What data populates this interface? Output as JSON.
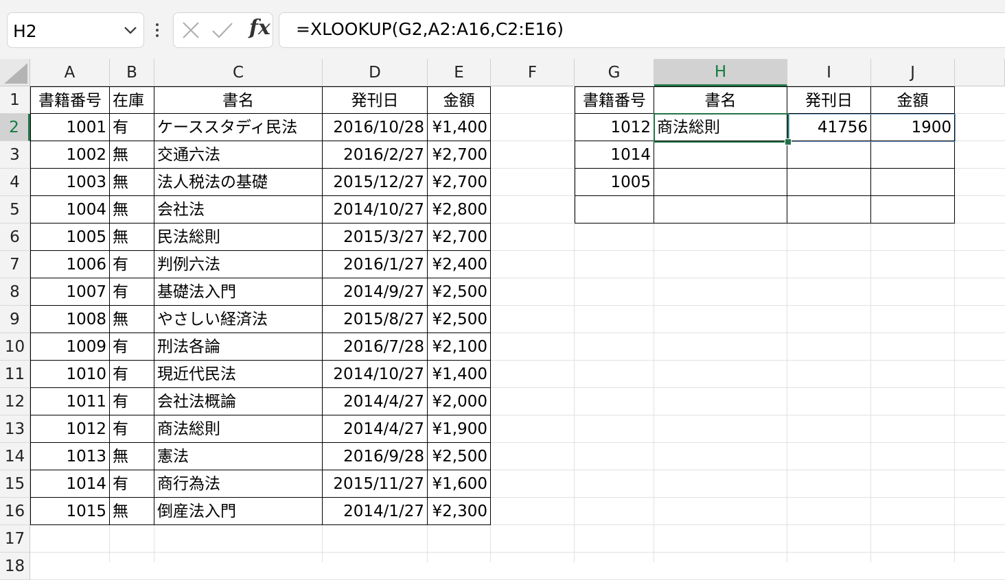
{
  "formula_bar": {
    "name_box": "H2",
    "fx_label": "fx",
    "formula": "=XLOOKUP(G2,A2:A16,C2:E16)"
  },
  "columns": [
    "A",
    "B",
    "C",
    "D",
    "E",
    "F",
    "G",
    "H",
    "I",
    "J"
  ],
  "rows": [
    "1",
    "2",
    "3",
    "4",
    "5",
    "6",
    "7",
    "8",
    "9",
    "10",
    "11",
    "12",
    "13",
    "14",
    "15",
    "16",
    "17",
    "18"
  ],
  "table1": {
    "headers": [
      "書籍番号",
      "在庫",
      "書名",
      "発刊日",
      "金額"
    ],
    "rows": [
      [
        "1001",
        "有",
        "ケーススタディ民法",
        "2016/10/28",
        "¥1,400"
      ],
      [
        "1002",
        "無",
        "交通六法",
        "2016/2/27",
        "¥2,700"
      ],
      [
        "1003",
        "無",
        "法人税法の基礎",
        "2015/12/27",
        "¥2,700"
      ],
      [
        "1004",
        "無",
        "会社法",
        "2014/10/27",
        "¥2,800"
      ],
      [
        "1005",
        "無",
        "民法総則",
        "2015/3/27",
        "¥2,700"
      ],
      [
        "1006",
        "有",
        "判例六法",
        "2016/1/27",
        "¥2,400"
      ],
      [
        "1007",
        "有",
        "基礎法入門",
        "2014/9/27",
        "¥2,500"
      ],
      [
        "1008",
        "無",
        "やさしい経済法",
        "2015/8/27",
        "¥2,500"
      ],
      [
        "1009",
        "有",
        "刑法各論",
        "2016/7/28",
        "¥2,100"
      ],
      [
        "1010",
        "有",
        "現近代民法",
        "2014/10/27",
        "¥1,400"
      ],
      [
        "1011",
        "有",
        "会社法概論",
        "2014/4/27",
        "¥2,000"
      ],
      [
        "1012",
        "有",
        "商法総則",
        "2014/4/27",
        "¥1,900"
      ],
      [
        "1013",
        "無",
        "憲法",
        "2016/9/28",
        "¥2,500"
      ],
      [
        "1014",
        "有",
        "商行為法",
        "2015/11/27",
        "¥1,600"
      ],
      [
        "1015",
        "無",
        "倒産法入門",
        "2014/1/27",
        "¥2,300"
      ]
    ]
  },
  "table2": {
    "headers": [
      "書籍番号",
      "書名",
      "発刊日",
      "金額"
    ],
    "rows": [
      [
        "1012",
        "商法総則",
        "41756",
        "1900"
      ],
      [
        "1014",
        "",
        "",
        ""
      ],
      [
        "1005",
        "",
        "",
        ""
      ],
      [
        "",
        "",
        "",
        ""
      ]
    ]
  },
  "active_cell": "H2"
}
